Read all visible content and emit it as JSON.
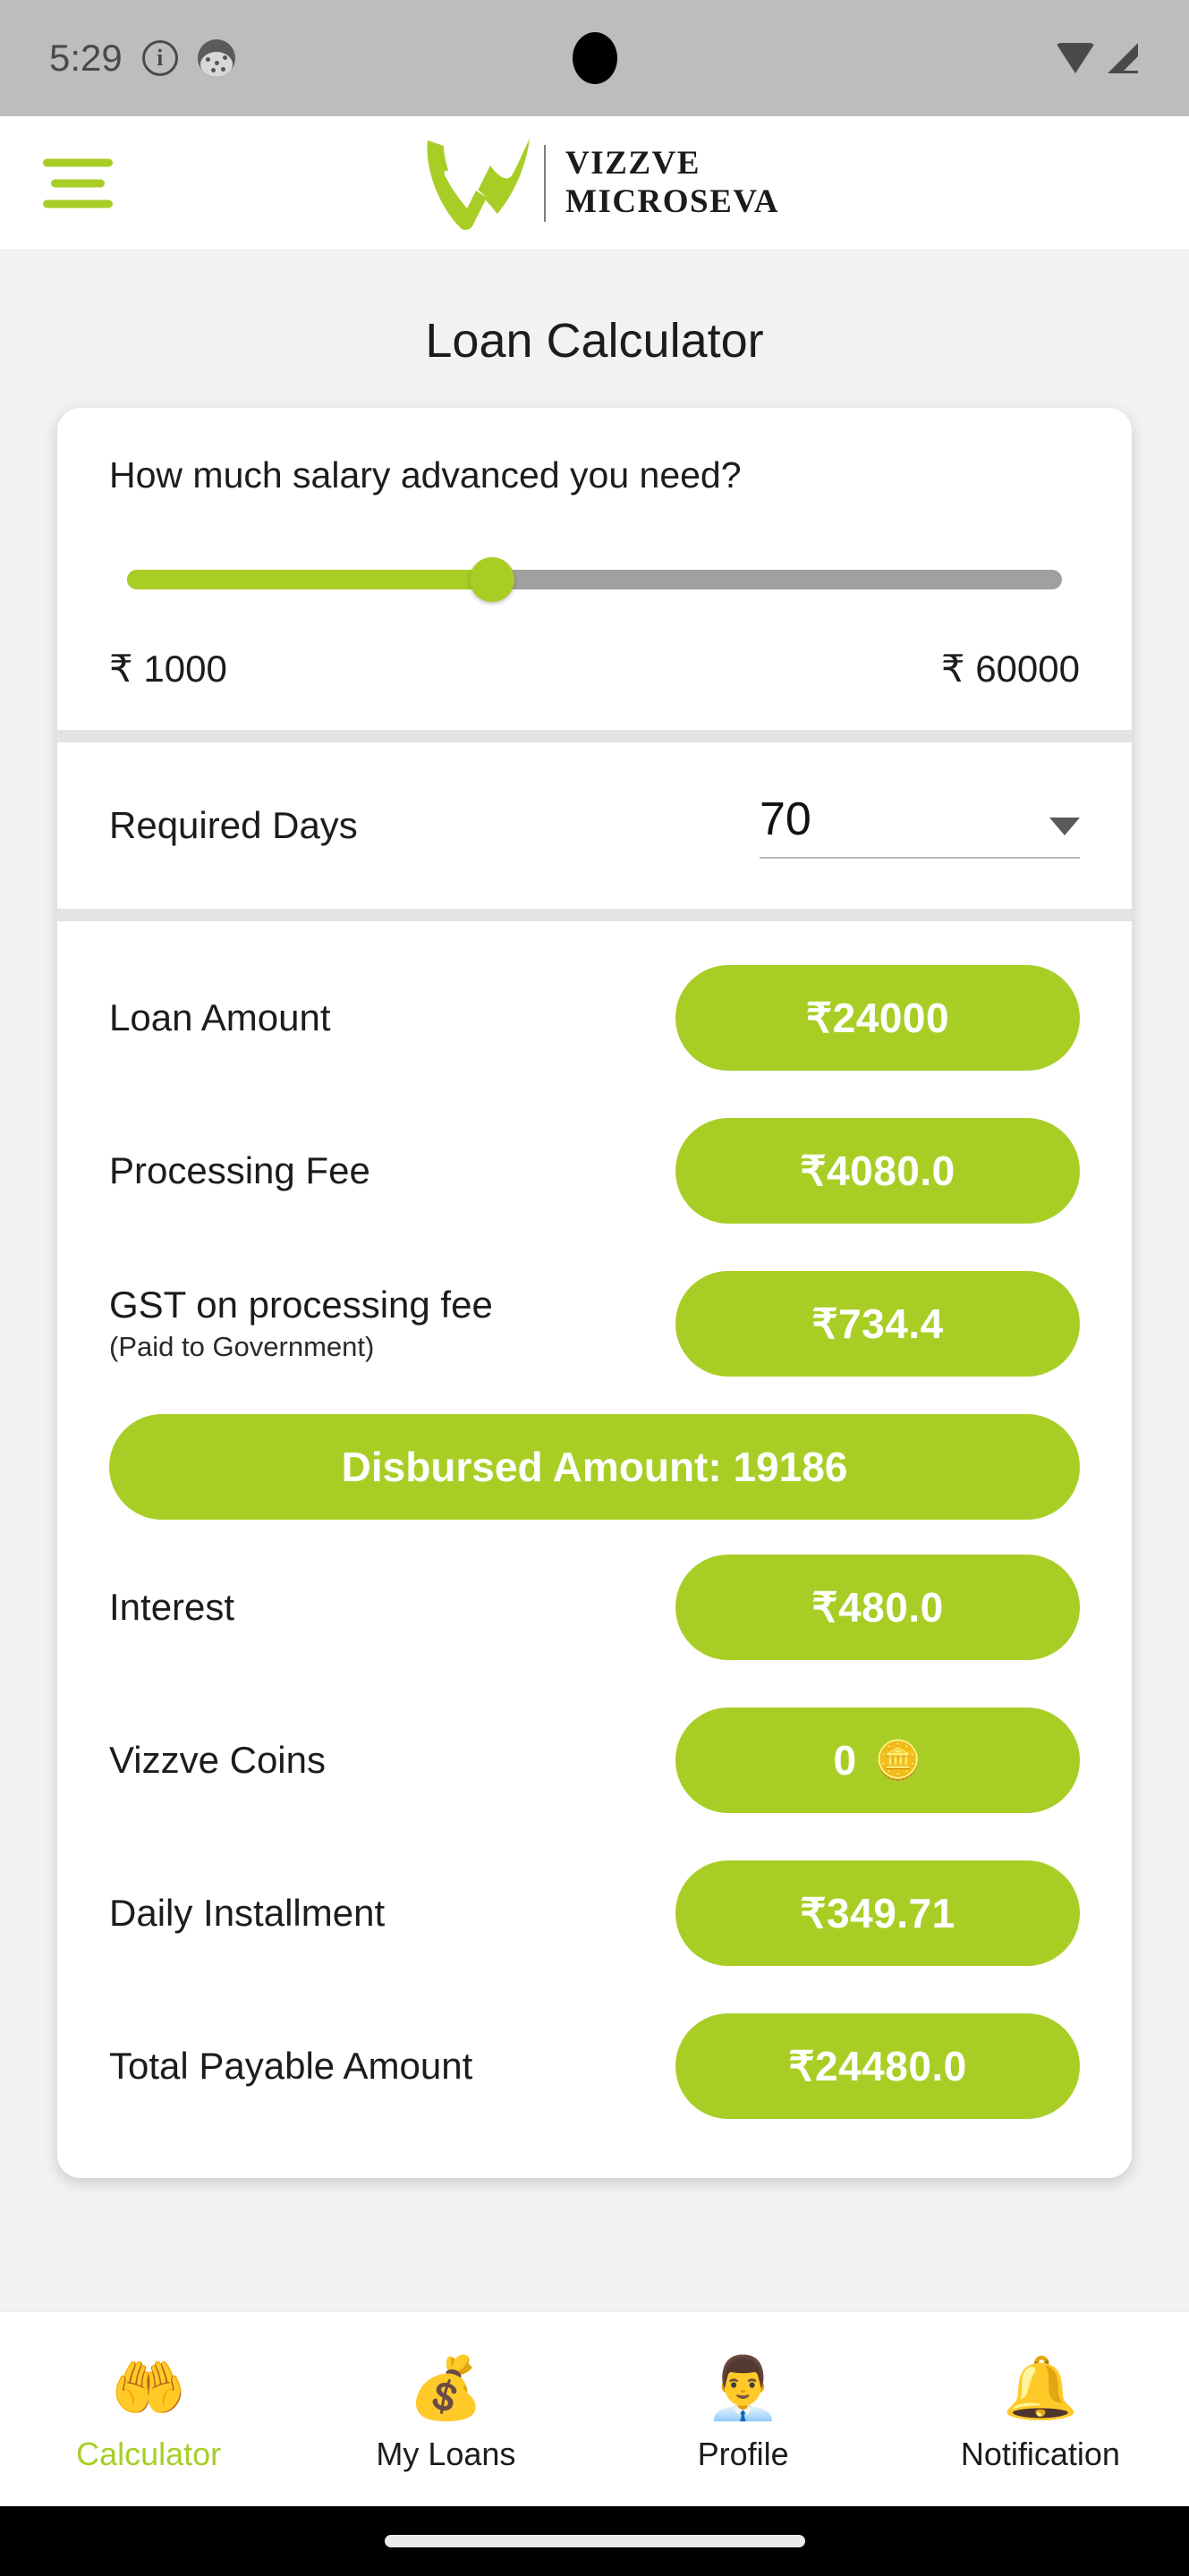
{
  "status_bar": {
    "time": "5:29",
    "info_icon": "info-icon",
    "app_icon": "app-badge-icon",
    "wifi_icon": "wifi-icon",
    "signal_icon": "cellular-signal-icon"
  },
  "header": {
    "menu_icon": "hamburger-menu-icon",
    "logo_icon": "vizzve-v-logo",
    "brand_line1": "VIZZVE",
    "brand_line2": "MICROSEVA",
    "brand_color": "#a8ce26"
  },
  "page": {
    "title": "Loan Calculator",
    "accent_color": "#a8ce26",
    "background": "#f2f2f2"
  },
  "slider_section": {
    "question": "How much salary advanced you need?",
    "min_label": "₹ 1000",
    "max_label": "₹ 60000",
    "min_value": 1000,
    "max_value": 60000,
    "current_value": 24000,
    "fill_percent": 39,
    "track_color": "#a0a0a0",
    "fill_color": "#a8ce26"
  },
  "days_section": {
    "label": "Required Days",
    "selected": "70",
    "caret_icon": "chevron-down-icon"
  },
  "results": {
    "rows": [
      {
        "label": "Loan Amount",
        "sub": "",
        "value": "₹24000"
      },
      {
        "label": "Processing Fee",
        "sub": "",
        "value": "₹4080.0"
      },
      {
        "label": "GST on processing fee",
        "sub": "(Paid to Government)",
        "value": "₹734.4"
      }
    ],
    "banner": "Disbursed Amount: 19186",
    "rows2": [
      {
        "label": "Interest",
        "sub": "",
        "value": "₹480.0"
      },
      {
        "label": "Vizzve Coins",
        "sub": "",
        "value": "0",
        "coin_icon": "🪙"
      },
      {
        "label": "Daily Installment",
        "sub": "",
        "value": "₹349.71"
      },
      {
        "label": "Total Payable Amount",
        "sub": "",
        "value": "₹24480.0"
      }
    ]
  },
  "bottom_nav": {
    "items": [
      {
        "label": "Calculator",
        "icon": "🤲",
        "icon_name": "money-exchange-icon",
        "active": true
      },
      {
        "label": "My Loans",
        "icon": "💰",
        "icon_name": "wallet-money-icon",
        "active": false
      },
      {
        "label": "Profile",
        "icon": "👨‍💼",
        "icon_name": "user-profile-icon",
        "active": false
      },
      {
        "label": "Notification",
        "icon": "🔔",
        "icon_name": "bell-icon",
        "active": false
      }
    ],
    "active_color": "#a8ce26"
  }
}
